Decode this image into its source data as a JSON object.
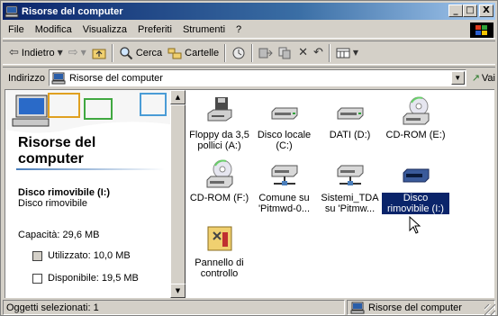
{
  "window": {
    "title": "Risorse del computer",
    "min": "_",
    "max": "□",
    "close": "X"
  },
  "menu": [
    "File",
    "Modifica",
    "Visualizza",
    "Preferiti",
    "Strumenti",
    "?"
  ],
  "toolbar": {
    "back": "Indietro",
    "search": "Cerca",
    "folders": "Cartelle"
  },
  "address": {
    "label": "Indirizzo",
    "value": "Risorse del computer",
    "go": "Vai"
  },
  "left_pane": {
    "title": "Risorse del computer",
    "selected_name": "Disco rimovibile (I:)",
    "selected_type": "Disco rimovibile",
    "capacity": "Capacità: 29,6 MB",
    "used": "Utilizzato: 10,0 MB",
    "free": "Disponibile: 19,5 MB"
  },
  "items": [
    {
      "label": "Floppy da 3,5 pollici (A:)",
      "icon": "floppy-drive-icon"
    },
    {
      "label": "Disco locale (C:)",
      "icon": "hard-drive-icon"
    },
    {
      "label": "DATI (D:)",
      "icon": "hard-drive-icon"
    },
    {
      "label": "CD-ROM (E:)",
      "icon": "cdrom-drive-icon"
    },
    {
      "label": "CD-ROM (F:)",
      "icon": "cdrom-drive-icon"
    },
    {
      "label": "Comune su 'Pitmwd-0...",
      "icon": "network-drive-icon"
    },
    {
      "label": "Sistemi_TDA su 'Pitmw...",
      "icon": "network-drive-icon"
    },
    {
      "label": "Disco rimovibile (I:)",
      "icon": "removable-drive-icon",
      "selected": true
    },
    {
      "label": "Pannello di controllo",
      "icon": "control-panel-icon"
    }
  ],
  "status": {
    "left": "Oggetti selezionati: 1",
    "right": "Risorse del computer"
  },
  "colors": {
    "title_start": "#0a246a",
    "title_end": "#a6caf0",
    "selection": "#0a246a",
    "used": "#d4d0c8",
    "free": "#ffffff"
  }
}
